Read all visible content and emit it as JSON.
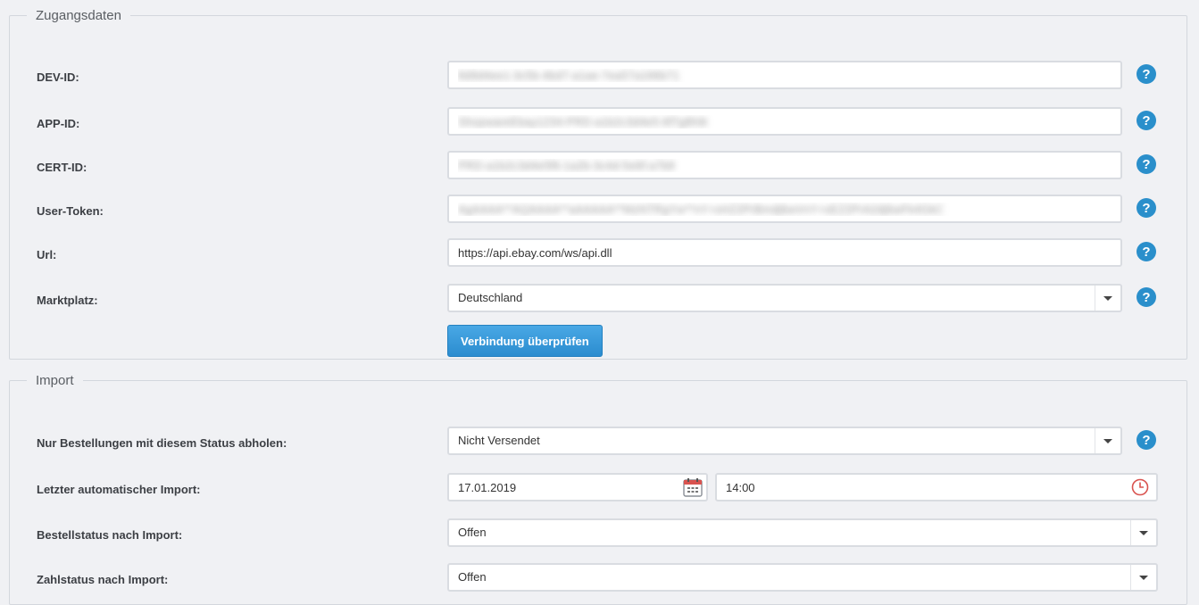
{
  "access": {
    "legend": "Zugangsdaten",
    "fields": [
      {
        "label": "DEV-ID:",
        "value": "8d9d4ee1-3c5b-4bd7-a1ae-7ea57a196b71"
      },
      {
        "label": "APP-ID:",
        "value": "ShopwareEbay1234-PRD-a1b2c3d4e5-6f7g8h9i"
      },
      {
        "label": "CERT-ID:",
        "value": "PRD-a1b2c3d4e5f6-1a2b-3c4d-5e6f-a7b8"
      },
      {
        "label": "User-Token:",
        "value": "AgAAAA**AQAAAA**aAAAAA**MzNTRgYw**nY+sHZ2PrBmdj6wVnY+sEZ2PrA2dj6wFk4GkC"
      },
      {
        "label": "Url:",
        "value": "https://api.ebay.com/ws/api.dll"
      }
    ],
    "marketplace": {
      "label": "Marktplatz:",
      "value": "Deutschland"
    },
    "check_button": "Verbindung überprüfen"
  },
  "import": {
    "legend": "Import",
    "status_filter": {
      "label": "Nur Bestellungen mit diesem Status abholen:",
      "value": "Nicht Versendet"
    },
    "last_import": {
      "label": "Letzter automatischer Import:",
      "date": "17.01.2019",
      "time": "14:00"
    },
    "order_status": {
      "label": "Bestellstatus nach Import:",
      "value": "Offen"
    },
    "payment_status": {
      "label": "Zahlstatus nach Import:",
      "value": "Offen"
    }
  },
  "help_glyph": "?",
  "icons": [
    "help-icon",
    "calendar-icon",
    "clock-icon",
    "chevron-down-icon"
  ],
  "colors": {
    "primary": "#2b8ccf",
    "help": "#2a8fcb",
    "clock": "#d9534f"
  }
}
